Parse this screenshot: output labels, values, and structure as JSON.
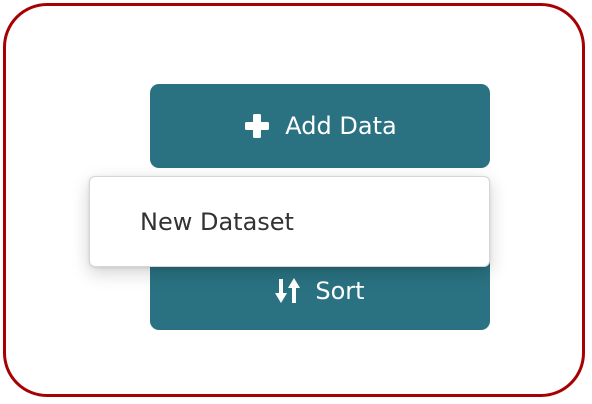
{
  "toolbar": {
    "add_data": {
      "label": "Add Data",
      "icon": "plus-icon"
    },
    "sort": {
      "label": "Sort",
      "icon": "sort-arrows-icon"
    }
  },
  "add_data_menu": {
    "items": [
      {
        "label": "New Dataset"
      }
    ]
  },
  "colors": {
    "button_bg": "#2a7282",
    "button_text": "#ffffff",
    "frame_border": "#a80000",
    "menu_text": "#333333"
  }
}
